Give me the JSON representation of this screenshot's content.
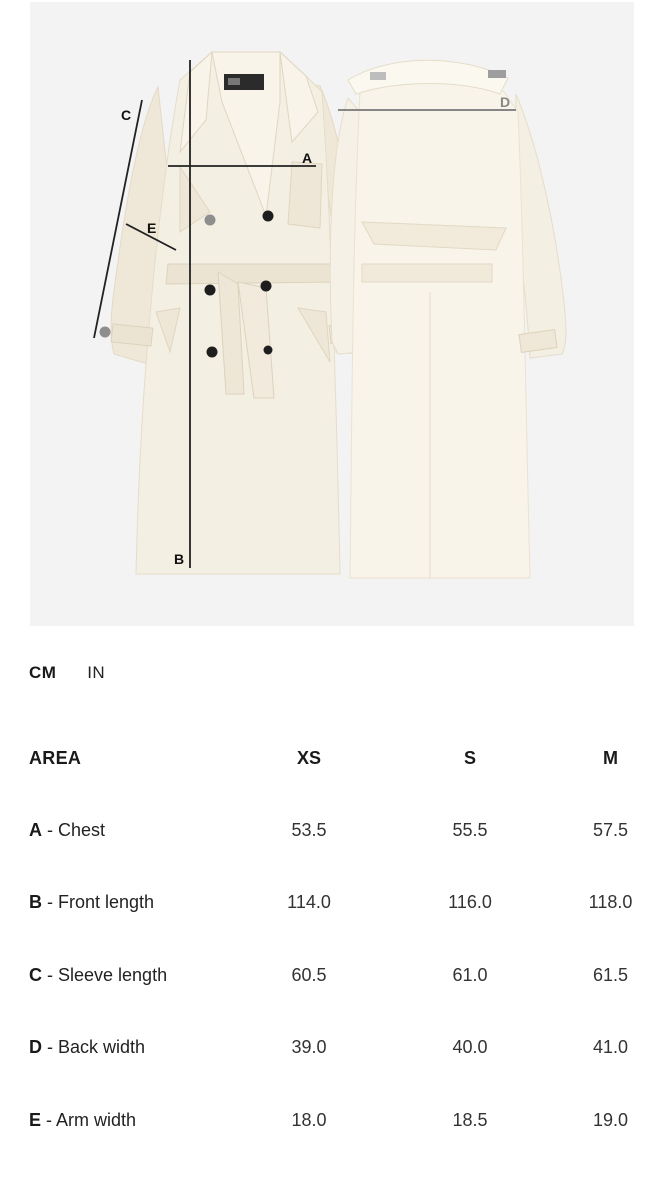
{
  "product_image": {
    "labels": {
      "a": "A",
      "b": "B",
      "c": "C",
      "d": "D",
      "e": "E"
    }
  },
  "unit_toggle": {
    "cm_label": "CM",
    "in_label": "IN",
    "selected": "CM"
  },
  "size_table": {
    "headers": [
      "AREA",
      "XS",
      "S",
      "M"
    ],
    "rows": [
      {
        "code": "A",
        "separator": " - ",
        "name": "Chest",
        "values": [
          "53.5",
          "55.5",
          "57.5"
        ]
      },
      {
        "code": "B",
        "separator": " - ",
        "name": "Front length",
        "values": [
          "114.0",
          "116.0",
          "118.0"
        ]
      },
      {
        "code": "C",
        "separator": " - ",
        "name": "Sleeve length",
        "values": [
          "60.5",
          "61.0",
          "61.5"
        ]
      },
      {
        "code": "D",
        "separator": " - ",
        "name": "Back width",
        "values": [
          "39.0",
          "40.0",
          "41.0"
        ]
      },
      {
        "code": "E",
        "separator": " - ",
        "name": "Arm width",
        "values": [
          "18.0",
          "18.5",
          "19.0"
        ]
      }
    ]
  },
  "colors": {
    "coat": "#f4efe3",
    "background": "#f3f3f3",
    "measure_line": "#222222"
  }
}
